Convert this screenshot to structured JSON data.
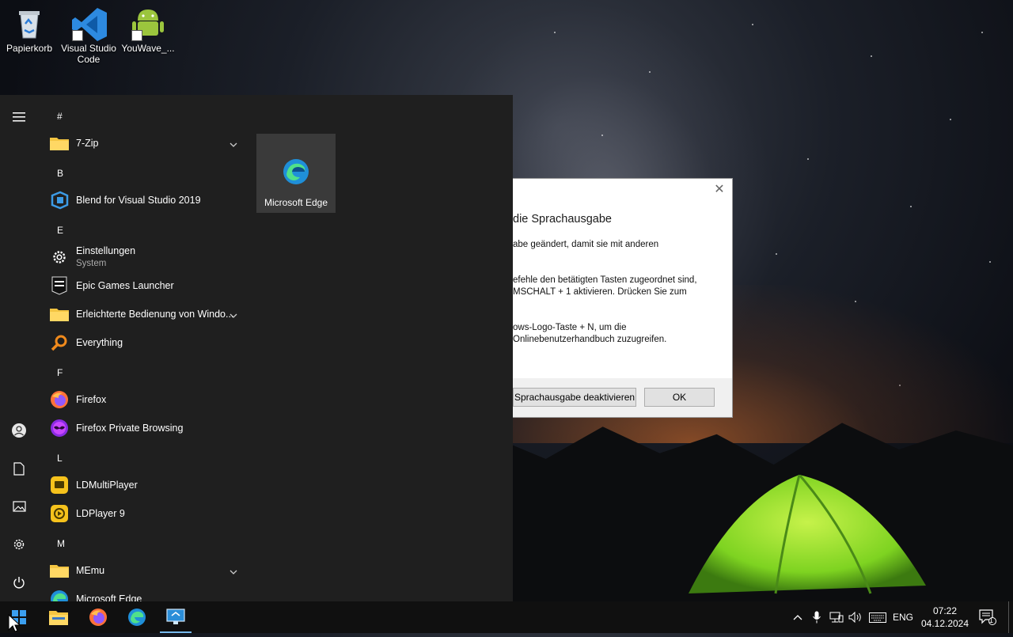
{
  "desktop": {
    "icons": [
      {
        "label": "Papierkorb"
      },
      {
        "label": "Visual Studio Code"
      },
      {
        "label": "YouWave_..."
      }
    ]
  },
  "start_menu": {
    "sections": {
      "hash": "#",
      "b": "B",
      "e": "E",
      "f": "F",
      "l": "L",
      "m": "M"
    },
    "apps": {
      "zip": "7-Zip",
      "blend": "Blend for Visual Studio 2019",
      "einstellungen": "Einstellungen",
      "einstellungen_sub": "System",
      "epic": "Epic Games Launcher",
      "erleichterte": "Erleichterte Bedienung von Windo...",
      "everything": "Everything",
      "firefox": "Firefox",
      "firefox_private": "Firefox Private Browsing",
      "ldmulti": "LDMultiPlayer",
      "ldplayer": "LDPlayer 9",
      "memu": "MEmu",
      "edge": "Microsoft Edge"
    },
    "tiles": [
      {
        "label": "Microsoft Edge"
      }
    ]
  },
  "dialog": {
    "heading": "die Sprachausgabe",
    "p1": [
      "abe geändert, damit sie mit anderen"
    ],
    "p2": [
      "efehle den betätigten Tasten zugeordnet sind,",
      "MSCHALT + 1 aktivieren. Drücken Sie zum"
    ],
    "p3": [
      "ows-Logo-Taste + N, um die",
      "Onlinebenutzerhandbuch zuzugreifen."
    ],
    "btn_disable": "Sprachausgabe deaktivieren",
    "btn_ok": "OK"
  },
  "taskbar": {
    "language": "ENG",
    "time": "07:22",
    "date": "04.12.2024",
    "notification_count": "1"
  },
  "colors": {
    "menu_bg": "#1f1f1f",
    "taskbar_bg": "#101010",
    "accent": "#76b9ed",
    "tent": "#7ed321"
  }
}
